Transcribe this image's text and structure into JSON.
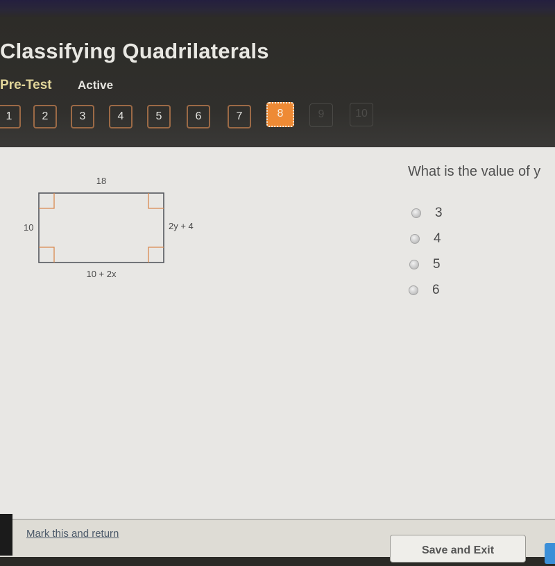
{
  "header": {
    "title": "Classifying Quadrilaterals",
    "subtitle": "Pre-Test",
    "status": "Active"
  },
  "question_nav": [
    {
      "label": "1",
      "state": "answered"
    },
    {
      "label": "2",
      "state": "answered"
    },
    {
      "label": "3",
      "state": "answered"
    },
    {
      "label": "4",
      "state": "answered"
    },
    {
      "label": "5",
      "state": "answered"
    },
    {
      "label": "6",
      "state": "answered"
    },
    {
      "label": "7",
      "state": "answered"
    },
    {
      "label": "8",
      "state": "current"
    },
    {
      "label": "9",
      "state": "disabled"
    },
    {
      "label": "10",
      "state": "disabled"
    }
  ],
  "diagram": {
    "shape": "rectangle",
    "top_label": "18",
    "left_label": "10",
    "right_label": "2y + 4",
    "bottom_label": "10 + 2x",
    "right_angle_marks": 4
  },
  "question": {
    "text": "What is the value of y",
    "options": [
      "3",
      "4",
      "5",
      "6"
    ],
    "selected": null
  },
  "footer": {
    "mark_link": "Mark this and return",
    "save_exit": "Save and Exit"
  },
  "colors": {
    "accent": "#ee8a35",
    "header_bg": "#2d2c28",
    "subtitle": "#e2d69a",
    "content_bg": "#e8e7e4",
    "right_angle_mark": "#d9894f"
  }
}
